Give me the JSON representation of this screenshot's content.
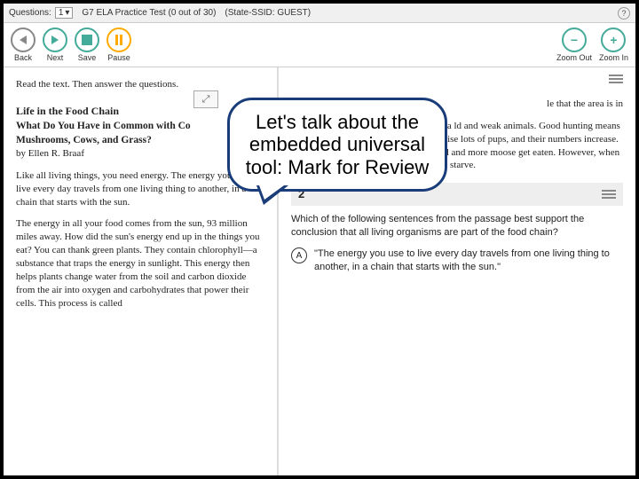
{
  "topbar": {
    "questions_label": "Questions:",
    "question_number": "1",
    "test_title": "G7 ELA Practice Test (0 out of 30)",
    "state_ssid": "(State-SSID: GUEST)"
  },
  "toolbar": {
    "back": "Back",
    "next": "Next",
    "save": "Save",
    "pause": "Pause",
    "zoom_out": "Zoom Out",
    "zoom_in": "Zoom In"
  },
  "left": {
    "instruction": "Read the text. Then answer the questions.",
    "title": "Life in the Food Chain",
    "subtitle1": "What Do You Have in Common with Co",
    "subtitle2": "Mushrooms, Cows, and Grass?",
    "author": "by Ellen R. Braaf",
    "para1": "Like all living things, you need energy. The energy you use to live every day travels from one living thing to another, in a chain that starts with the sun.",
    "para2": "The energy in all your food comes from the sun, 93 million miles away. How did the sun's energy end up in the things you eat? You can thank green plants. They contain chlorophyll—a substance that traps the energy in sunlight. This energy then helps plants change water from the soil and carbon dioxide from the air into oxygen and carbohydrates that power their cells. This process is called"
  },
  "right": {
    "para1_frag": "le that the area is in",
    "para2": "en predator and prey. g, strong legs and a ld and weak animals. Good hunting means food for the whole pack. Wolves then raise lots of pups, and their numbers increase. More wolves mean more mouths to feed and more moose get eaten. However, when the moose population decreases, wolves starve.",
    "question_number": "2",
    "question_text": "Which of the following sentences from the passage best support the conclusion that all living organisms are part of the food chain?",
    "choice_a_letter": "A",
    "choice_a_text": "\"The energy you use to live every day travels from one living thing to another, in a chain that starts with the sun.\""
  },
  "callout": {
    "text": "Let's talk about the embedded universal tool: Mark for Review"
  }
}
